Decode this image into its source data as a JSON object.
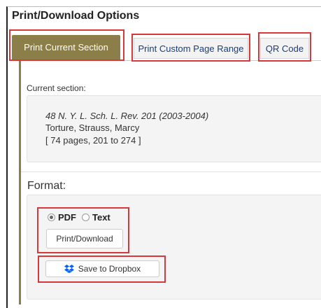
{
  "dialog": {
    "title": "Print/Download Options"
  },
  "tabs": [
    {
      "label": "Print Current Section",
      "active": true
    },
    {
      "label": "Print Custom Page Range",
      "active": false
    },
    {
      "label": "QR Code",
      "active": false
    }
  ],
  "current_section": {
    "label": "Current section:",
    "citation": "48 N. Y. L. Sch. L. Rev. 201 (2003-2004)",
    "title_author": "Torture, Strauss, Marcy",
    "pages": "[ 74 pages, 201 to 274 ]"
  },
  "format": {
    "label": "Format:",
    "options": [
      {
        "label": "PDF",
        "selected": true
      },
      {
        "label": "Text",
        "selected": false
      }
    ],
    "print_button": "Print/Download",
    "dropbox_button": "Save to Dropbox"
  },
  "colors": {
    "accent": "#8c7e48",
    "highlight": "#d9383a",
    "link": "#1a3d7c",
    "dropbox": "#0061fe"
  }
}
